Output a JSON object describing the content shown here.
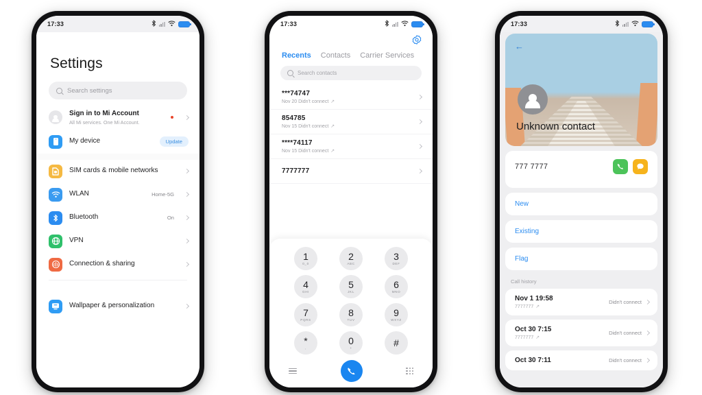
{
  "status_bar": {
    "time": "17:33",
    "icons": [
      "bluetooth-icon",
      "signal-bars-icon",
      "wifi-icon",
      "battery-icon"
    ]
  },
  "colors": {
    "accent_blue": "#2b8cf0",
    "green": "#4cc35a",
    "yellow": "#f6b31c",
    "red_dot": "#e8442a"
  },
  "phone1": {
    "title": "Settings",
    "search": {
      "placeholder": "Search settings",
      "icon": "search-icon"
    },
    "items": [
      {
        "icon": "account-avatar-icon",
        "label": "Sign in to Mi Account",
        "sub": "All Mi services. One Mi Account.",
        "value": "",
        "badge": "",
        "dot": true
      },
      {
        "icon": "my-device-icon",
        "label": "My device",
        "sub": "",
        "value": "",
        "badge": "Update",
        "dot": false
      },
      {
        "icon": "sim-card-icon",
        "label": "SIM cards & mobile networks",
        "sub": "",
        "value": "",
        "badge": "",
        "dot": false
      },
      {
        "icon": "wlan-icon",
        "label": "WLAN",
        "sub": "",
        "value": "Home-5G",
        "badge": "",
        "dot": false
      },
      {
        "icon": "bluetooth-icon",
        "label": "Bluetooth",
        "sub": "",
        "value": "On",
        "badge": "",
        "dot": false
      },
      {
        "icon": "vpn-globe-icon",
        "label": "VPN",
        "sub": "",
        "value": "",
        "badge": "",
        "dot": false
      },
      {
        "icon": "connection-sharing-icon",
        "label": "Connection & sharing",
        "sub": "",
        "value": "",
        "badge": "",
        "dot": false
      },
      {
        "icon": "wallpaper-icon",
        "label": "Wallpaper & personalization",
        "sub": "",
        "value": "",
        "badge": "",
        "dot": false
      }
    ]
  },
  "phone2": {
    "gear_icon": "settings-gear-icon",
    "tabs": [
      {
        "label": "Recents",
        "active": true
      },
      {
        "label": "Contacts",
        "active": false
      },
      {
        "label": "Carrier Services",
        "active": false
      }
    ],
    "search": {
      "placeholder": "Search contacts",
      "icon": "search-icon"
    },
    "calls": [
      {
        "number": "***74747",
        "detail": "Nov 20 Didn't connect"
      },
      {
        "number": "854785",
        "detail": "Nov 15 Didn't connect"
      },
      {
        "number": "****74117",
        "detail": "Nov 15 Didn't connect"
      },
      {
        "number": "7777777",
        "detail": ""
      }
    ],
    "keypad": [
      {
        "digit": "1",
        "letters": "0_0"
      },
      {
        "digit": "2",
        "letters": "ABC"
      },
      {
        "digit": "3",
        "letters": "DEF"
      },
      {
        "digit": "4",
        "letters": "GHI"
      },
      {
        "digit": "5",
        "letters": "JKL"
      },
      {
        "digit": "6",
        "letters": "MNO"
      },
      {
        "digit": "7",
        "letters": "PQRS"
      },
      {
        "digit": "8",
        "letters": "TUV"
      },
      {
        "digit": "9",
        "letters": "WXYZ"
      },
      {
        "digit": "*",
        "letters": ","
      },
      {
        "digit": "0",
        "letters": "+"
      },
      {
        "digit": "#",
        "letters": ""
      }
    ],
    "bottom_bar": {
      "menu_icon": "hamburger-menu-icon",
      "call_icon": "call-icon",
      "keypad_icon": "keypad-dots-icon"
    }
  },
  "phone3": {
    "back_icon": "back-arrow-icon",
    "avatar_icon": "contact-avatar-icon",
    "name": "Unknown contact",
    "number": "777 7777",
    "actions": [
      {
        "icon": "call-icon",
        "name": "call-action"
      },
      {
        "icon": "message-icon",
        "name": "message-action"
      }
    ],
    "links": [
      {
        "label": "New"
      },
      {
        "label": "Existing"
      },
      {
        "label": "Flag"
      }
    ],
    "history_label": "Call history",
    "history": [
      {
        "date": "Nov 1 19:58",
        "number": "7777777",
        "status": "Didn't connect"
      },
      {
        "date": "Oct 30 7:15",
        "number": "7777777",
        "status": "Didn't connect"
      },
      {
        "date": "Oct 30 7:11",
        "number": "",
        "status": "Didn't connect"
      }
    ]
  }
}
